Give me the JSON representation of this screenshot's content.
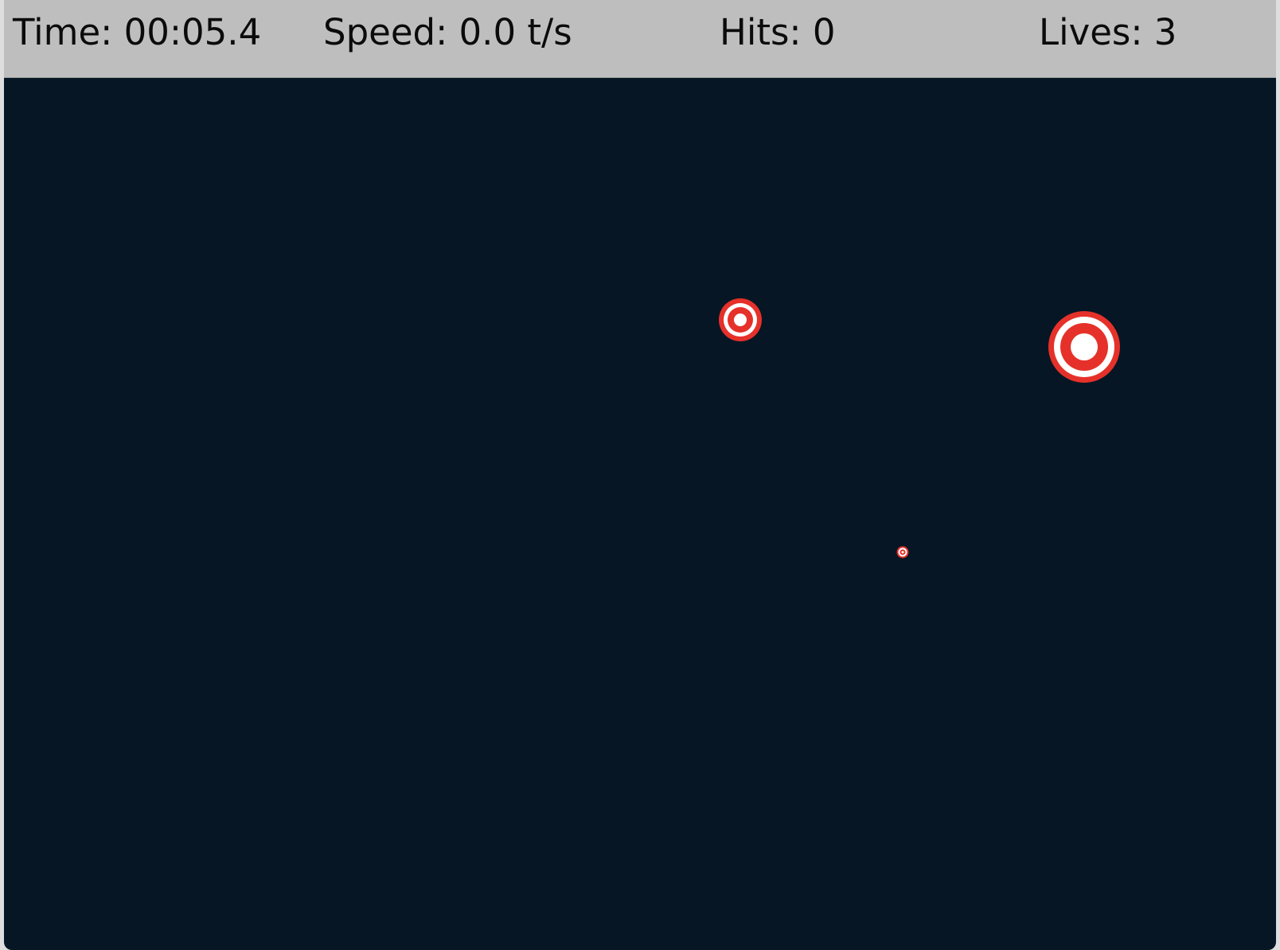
{
  "hud": {
    "time_text": "Time: 00:05.4",
    "speed_text": "Speed: 0.0 t/s",
    "hits_text": "Hits: 0",
    "lives_text": "Lives: 3"
  },
  "colors": {
    "hud_background": "#bebebe",
    "playfield_background": "#061624",
    "target_red": "#e5312a",
    "target_white": "#ffffff"
  },
  "targets": [
    {
      "name": "target-medium",
      "icon": "bullseye-icon"
    },
    {
      "name": "target-large",
      "icon": "bullseye-icon"
    },
    {
      "name": "target-small",
      "icon": "bullseye-icon"
    }
  ]
}
